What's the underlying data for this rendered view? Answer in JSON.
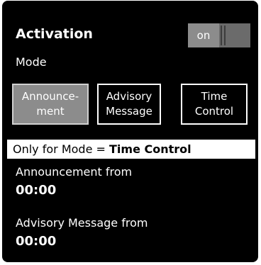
{
  "activation": {
    "title": "Activation",
    "toggle_label": "on"
  },
  "mode": {
    "label": "Mode",
    "options": [
      {
        "line1": "Announce-",
        "line2": "ment",
        "selected": true
      },
      {
        "line1": "Advisory",
        "line2": "Message",
        "selected": false
      },
      {
        "line1": "Time",
        "line2": "Control",
        "selected": false
      }
    ]
  },
  "info": {
    "prefix": "Only for Mode = ",
    "highlight": "Time Control"
  },
  "announcement_from": {
    "label": "Announcement from",
    "value": "00:00"
  },
  "advisory_from": {
    "label": "Advisory Message from",
    "value": "00:00"
  }
}
